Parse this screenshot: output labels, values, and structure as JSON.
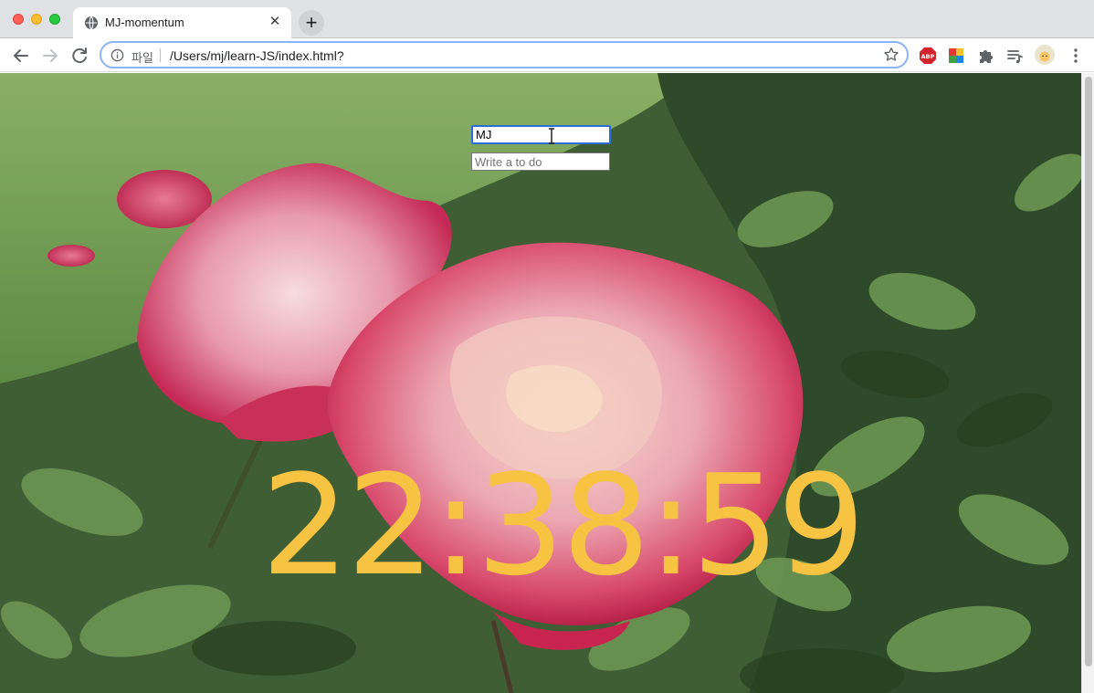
{
  "browser": {
    "tab_title": "MJ-momentum",
    "tab_close": "✕",
    "new_tab": "+",
    "scheme_label": "파일",
    "url": "/Users/mj/learn-JS/index.html?",
    "ext_abp": "ABP"
  },
  "page": {
    "name_input_value": "MJ",
    "todo_placeholder": "Write a to do",
    "clock_text": "22:38:59",
    "clock_color": "#f7c343"
  }
}
